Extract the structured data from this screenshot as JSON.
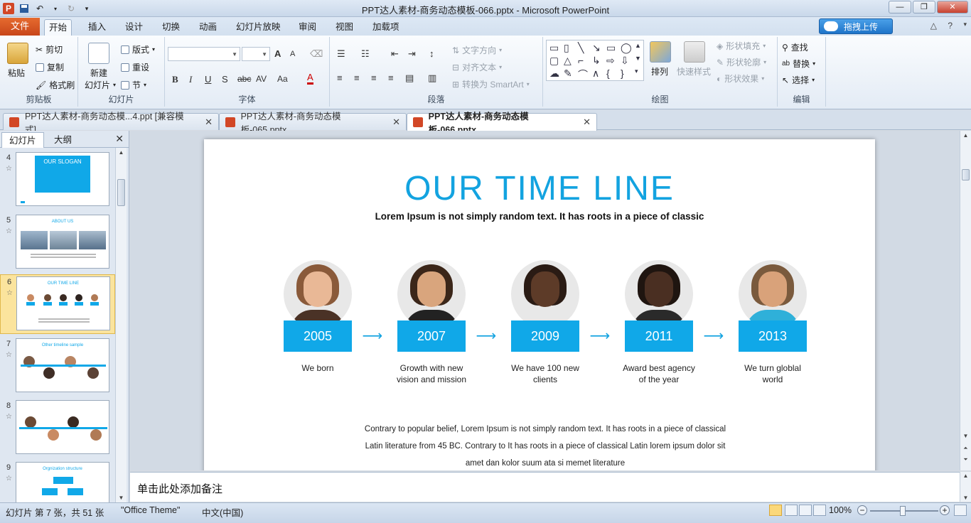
{
  "window": {
    "title": "PPT达人素材-商务动态模板-066.pptx - Microsoft PowerPoint",
    "controls": [
      "—",
      "❐",
      "✕"
    ]
  },
  "tabs": {
    "file": "文件",
    "items": [
      "开始",
      "插入",
      "设计",
      "切换",
      "动画",
      "幻灯片放映",
      "审阅",
      "视图",
      "加载项"
    ],
    "active": "开始",
    "upload_label": "拖拽上传"
  },
  "ribbon": {
    "clipboard": {
      "paste": "粘贴",
      "cut": "剪切",
      "copy": "复制",
      "format_painter": "格式刷",
      "label": "剪贴板"
    },
    "slides": {
      "new_slide": "新建",
      "new_slide2": "幻灯片",
      "layout": "版式",
      "reset": "重设",
      "section": "节",
      "label": "幻灯片"
    },
    "font": {
      "font_name": "",
      "font_size": "",
      "bold": "B",
      "italic": "I",
      "underline": "U",
      "shadow": "S",
      "strike": "abc",
      "spacing": "AV",
      "case": "Aa",
      "color": "A",
      "grow": "A",
      "shrink": "A",
      "label": "字体"
    },
    "paragraph": {
      "text_direction": "文字方向",
      "align_text": "对齐文本",
      "smartart": "转换为 SmartArt",
      "label": "段落"
    },
    "drawing": {
      "arrange": "排列",
      "quick_styles": "快速样式",
      "shape_fill": "形状填充",
      "shape_outline": "形状轮廓",
      "shape_effects": "形状效果",
      "label": "绘图"
    },
    "editing": {
      "find": "查找",
      "replace": "替换",
      "select": "选择",
      "label": "编辑"
    }
  },
  "doc_tabs": [
    {
      "label": "PPT达人素材-商务动态模...4.ppt [兼容模式]"
    },
    {
      "label": "PPT达人素材-商务动态模板-065.pptx"
    },
    {
      "label": "PPT达人素材-商务动态模板-066.pptx"
    }
  ],
  "left_panel": {
    "tab_slides": "幻灯片",
    "tab_outline": "大纲",
    "slides": [
      {
        "num": "4",
        "thumb_title": "OUR SLOGAN"
      },
      {
        "num": "5",
        "thumb_title": "ABOUT US"
      },
      {
        "num": "6",
        "thumb_title": "OUR TIME LINE"
      },
      {
        "num": "7",
        "thumb_title": "Other timeline sample"
      },
      {
        "num": "8",
        "thumb_title": ""
      },
      {
        "num": "9",
        "thumb_title": "Orgnization structure"
      }
    ]
  },
  "slide": {
    "title": "OUR TIME LINE",
    "subtitle": "Lorem Ipsum is not simply random text. It has roots in a piece of classic",
    "milestones": [
      {
        "year": "2005",
        "caption": "We born"
      },
      {
        "year": "2007",
        "caption": "Growth with new vision and mission"
      },
      {
        "year": "2009",
        "caption": "We have 100 new clients"
      },
      {
        "year": "2011",
        "caption": "Award best agency of the year"
      },
      {
        "year": "2013",
        "caption": "We turn globlal world"
      }
    ],
    "paragraph_lines": [
      "Contrary to  popular belief, Lorem  Ipsum is not simply random text.  It has roots in a piece of classical",
      "Latin literature from  45 BC.  Contrary to It has roots in a piece of classical Latin  lorem ipsum dolor sit",
      "amet dan kolor suum ata si memet  literature"
    ],
    "accent": "#10a8e8"
  },
  "notes": {
    "placeholder": "单击此处添加备注"
  },
  "status": {
    "slide_info": "幻灯片 第 7 张，共 51 张",
    "theme": "\"Office Theme\"",
    "language": "中文(中国)",
    "zoom": "100%"
  }
}
